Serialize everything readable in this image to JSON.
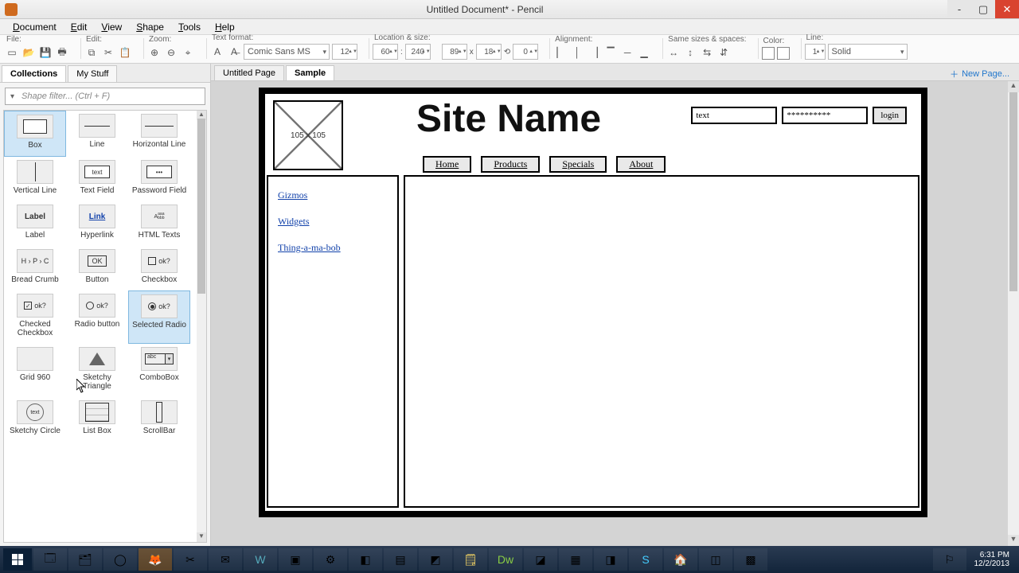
{
  "window": {
    "title": "Untitled Document* - Pencil",
    "min": "-",
    "max": "▢",
    "close": "✕"
  },
  "menu": {
    "items": [
      "Document",
      "Edit",
      "View",
      "Shape",
      "Tools",
      "Help"
    ]
  },
  "toolbar": {
    "groups": {
      "file": "File:",
      "edit": "Edit:",
      "zoom": "Zoom:",
      "textfmt": "Text format:",
      "locsize": "Location & size:",
      "align": "Alignment:",
      "samesize": "Same sizes & spaces:",
      "color": "Color:",
      "line": "Line:"
    },
    "font": "Comic Sans MS",
    "fontsize": "12",
    "loc_x": "60",
    "loc_y": "240",
    "size_w": "89",
    "size_h": "18",
    "rotation": "0",
    "linew": "1",
    "linestyle": "Solid"
  },
  "sidebar": {
    "tabs": [
      "Collections",
      "My Stuff"
    ],
    "active_tab": 0,
    "filter_placeholder": "Shape filter... (Ctrl + F)",
    "shapes": [
      [
        "Box",
        "Line",
        "Horizontal Line"
      ],
      [
        "Vertical Line",
        "Text Field",
        "Password Field"
      ],
      [
        "Label",
        "Hyperlink",
        "HTML Texts"
      ],
      [
        "Bread Crumb",
        "Button",
        "Checkbox"
      ],
      [
        "Checked Checkbox",
        "Radio button",
        "Selected Radio"
      ],
      [
        "Grid 960",
        "Sketchy Triangle",
        "ComboBox"
      ],
      [
        "Sketchy Circle",
        "List Box",
        "ScrollBar"
      ]
    ]
  },
  "pages": {
    "tabs": [
      "Untitled Page",
      "Sample"
    ],
    "active": 1,
    "new_label": "New Page..."
  },
  "mockup": {
    "img_label": "105 x 105",
    "title": "Site Name",
    "username": "text",
    "password": "**********",
    "login": "login",
    "nav": [
      "Home",
      "Products",
      "Specials",
      "About"
    ],
    "side_links": [
      "Gizmos",
      "Widgets",
      "Thing-a-ma-bob"
    ]
  },
  "clock": {
    "time": "6:31 PM",
    "date": "12/2/2013"
  }
}
